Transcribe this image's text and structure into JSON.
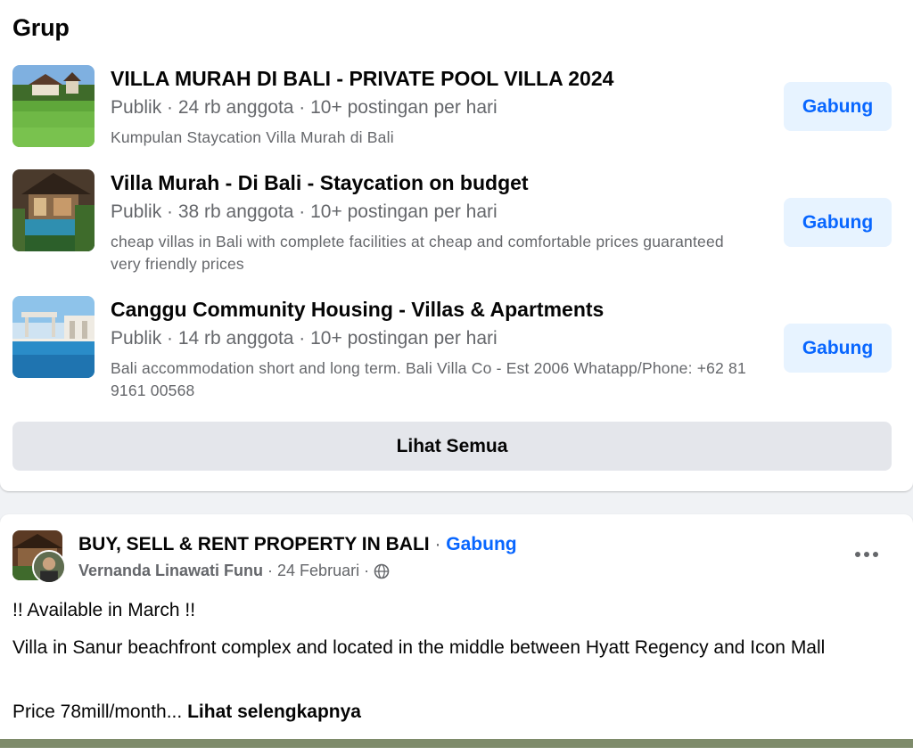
{
  "groups_section": {
    "title": "Grup",
    "see_all_label": "Lihat Semua",
    "items": [
      {
        "name": "VILLA MURAH DI BALI - PRIVATE POOL VILLA 2024",
        "meta": "Publik · 24 rb anggota · 10+ postingan per hari",
        "description": "Kumpulan Staycation Villa Murah di Bali",
        "join_label": "Gabung",
        "thumbnail_icon": "rice-field-villa-photo"
      },
      {
        "name": "Villa Murah - Di Bali - Staycation on budget",
        "meta": "Publik · 38 rb anggota · 10+ postingan per hari",
        "description": "cheap villas in Bali with complete facilities at cheap and comfortable prices guaranteed very friendly prices",
        "join_label": "Gabung",
        "thumbnail_icon": "pool-villa-photo"
      },
      {
        "name": "Canggu Community Housing - Villas & Apartments",
        "meta": "Publik · 14 rb anggota · 10+ postingan per hari",
        "description": "Bali accommodation short and long term. Bali Villa Co - Est 2006 Whatapp/Phone: +62 81 9161 00568",
        "join_label": "Gabung",
        "thumbnail_icon": "infinity-pool-photo"
      }
    ]
  },
  "post": {
    "group_name": "BUY, SELL & RENT PROPERTY IN BALI",
    "separator": "·",
    "join_label": "Gabung",
    "author": "Vernanda Linawati Funu",
    "date": "24 Februari",
    "privacy_icon": "globe-icon",
    "more_icon": "more-options-icon",
    "lines": [
      "!! Available in March !!",
      "Villa in Sanur beachfront complex and located in the middle between Hyatt Regency and Icon Mall",
      "Price 78mill/month..."
    ],
    "see_more_label": "Lihat selengkapnya"
  },
  "colors": {
    "accent": "#0866ff",
    "join_bg": "#e7f3ff",
    "secondary_text": "#65676b",
    "see_all_bg": "#e4e6eb"
  }
}
